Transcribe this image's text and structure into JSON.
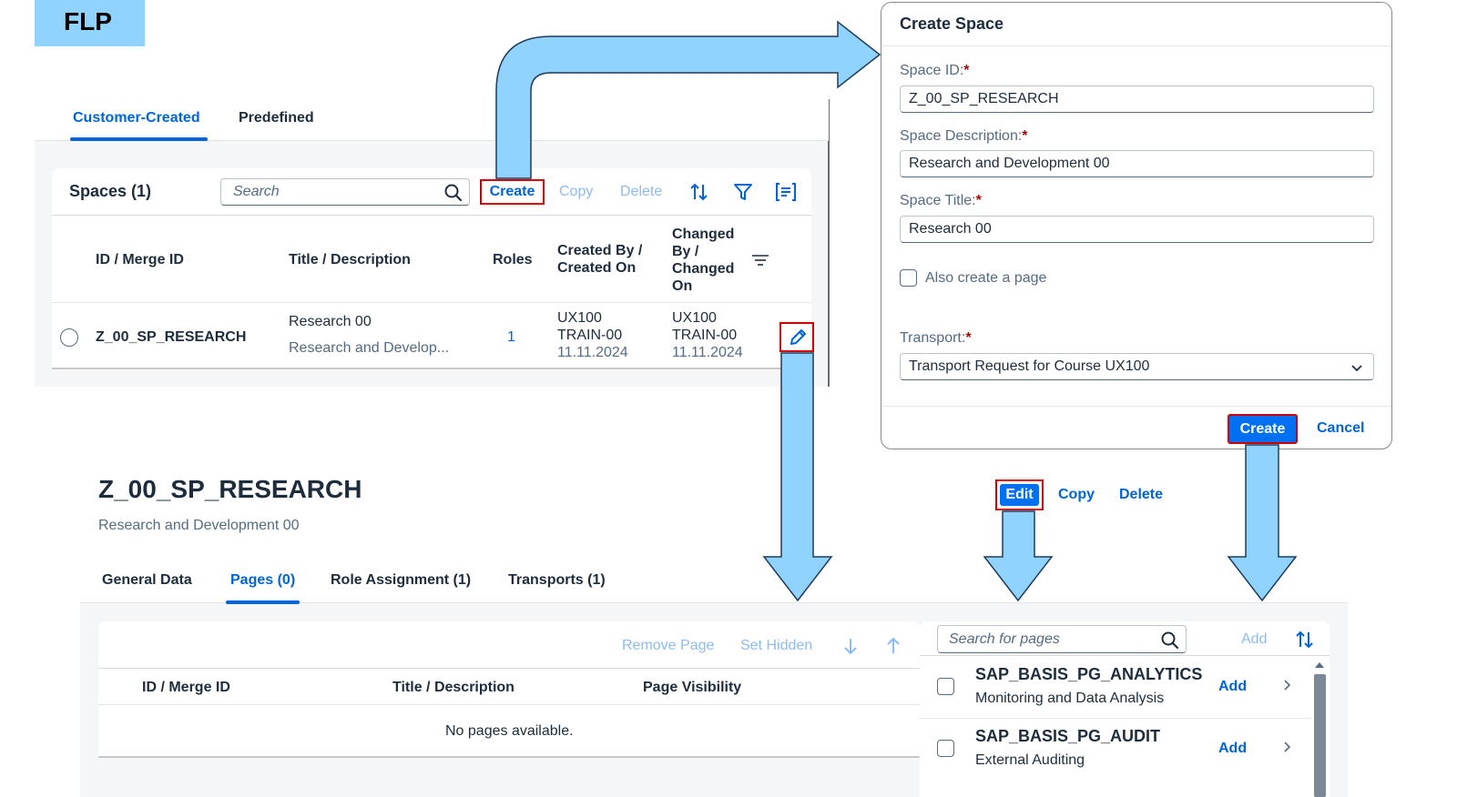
{
  "badge": {
    "label": "FLP"
  },
  "space_list": {
    "tabs": [
      {
        "label": "Customer-Created",
        "active": true
      },
      {
        "label": "Predefined",
        "active": false
      }
    ],
    "title": "Spaces (1)",
    "search": {
      "placeholder": "Search"
    },
    "toolbar": {
      "create": "Create",
      "copy": "Copy",
      "delete": "Delete"
    },
    "columns": [
      "ID / Merge ID",
      "Title / Description",
      "Roles",
      "Created By / Created On",
      "Changed By / Changed On"
    ],
    "rows": [
      {
        "id": "Z_00_SP_RESEARCH",
        "title": "Research 00",
        "description": "Research and Develop...",
        "roles": "1",
        "created_by": "UX100 TRAIN-00",
        "created_on": "11.11.2024",
        "changed_by": "UX100 TRAIN-00",
        "changed_on": "11.11.2024"
      }
    ]
  },
  "dialog": {
    "title": "Create Space",
    "space_id": {
      "label": "Space ID:",
      "value": "Z_00_SP_RESEARCH"
    },
    "space_description": {
      "label": "Space Description:",
      "value": "Research and Development 00"
    },
    "space_title": {
      "label": "Space Title:",
      "value": "Research 00"
    },
    "also_create_page": {
      "label": "Also create a page",
      "checked": false
    },
    "transport": {
      "label": "Transport:",
      "value": "Transport Request for Course UX100"
    },
    "required_marker": "*",
    "create": "Create",
    "cancel": "Cancel"
  },
  "space_detail": {
    "title": "Z_00_SP_RESEARCH",
    "subtitle": "Research and Development 00",
    "actions": {
      "edit": "Edit",
      "copy": "Copy",
      "delete": "Delete"
    },
    "tabs": [
      {
        "label": "General Data",
        "active": false
      },
      {
        "label": "Pages (0)",
        "active": true
      },
      {
        "label": "Role Assignment (1)",
        "active": false
      },
      {
        "label": "Transports (1)",
        "active": false
      }
    ],
    "pages_table": {
      "toolbar": {
        "remove": "Remove Page",
        "set_hidden": "Set Hidden"
      },
      "columns": [
        "ID / Merge ID",
        "Title / Description",
        "Page Visibility"
      ],
      "empty_text": "No pages available."
    },
    "available_pages": {
      "search": {
        "placeholder": "Search for pages"
      },
      "add": "Add",
      "items": [
        {
          "name": "SAP_BASIS_PG_ANALYTICS",
          "description": "Monitoring and Data Analysis",
          "action": "Add"
        },
        {
          "name": "SAP_BASIS_PG_AUDIT",
          "description": "External Auditing",
          "action": "Add"
        }
      ]
    }
  },
  "colors": {
    "brand_blue": "#0064d9",
    "emphasized_button": "#0070f2",
    "highlight_red": "#d10000",
    "arrow_fill": "#8fd3fe",
    "arrow_stroke": "#1f3b5a",
    "disabled_text": "#8dbbf3"
  }
}
